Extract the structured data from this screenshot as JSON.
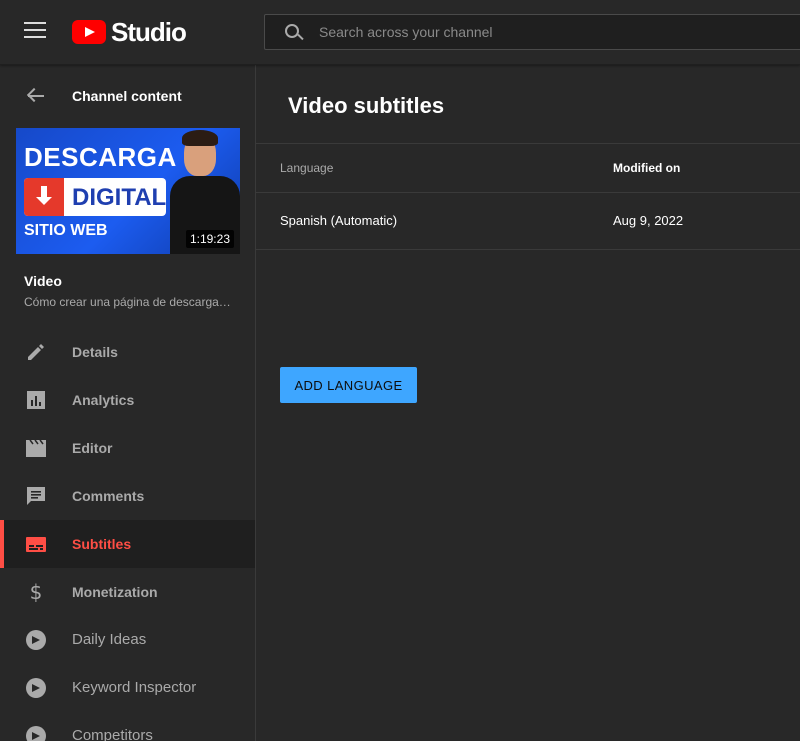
{
  "header": {
    "logo_text": "Studio",
    "search_placeholder": "Search across your channel"
  },
  "sidebar": {
    "back_label": "Channel content",
    "thumbnail": {
      "line1": "DESCARGA",
      "line2": "DIGITAL",
      "line3": "SITIO WEB",
      "duration": "1:19:23"
    },
    "video_heading": "Video",
    "video_title": "Cómo crear una página de descarga…",
    "items": [
      {
        "label": "Details",
        "icon": "pencil-icon",
        "active": false
      },
      {
        "label": "Analytics",
        "icon": "analytics-icon",
        "active": false
      },
      {
        "label": "Editor",
        "icon": "clapperboard-icon",
        "active": false
      },
      {
        "label": "Comments",
        "icon": "comment-icon",
        "active": false
      },
      {
        "label": "Subtitles",
        "icon": "subtitles-icon",
        "active": true
      },
      {
        "label": "Monetization",
        "icon": "dollar-icon",
        "active": false
      },
      {
        "label": "Daily Ideas",
        "icon": "extension-icon",
        "active": false
      },
      {
        "label": "Keyword Inspector",
        "icon": "extension-icon",
        "active": false
      },
      {
        "label": "Competitors",
        "icon": "extension-icon",
        "active": false
      }
    ]
  },
  "main": {
    "title": "Video subtitles",
    "table": {
      "headers": {
        "language": "Language",
        "modified": "Modified on"
      },
      "rows": [
        {
          "language": "Spanish (Automatic)",
          "modified": "Aug 9, 2022"
        }
      ]
    },
    "add_button": "ADD LANGUAGE"
  },
  "colors": {
    "accent_red": "#ff4e45",
    "button_blue": "#3ea6ff",
    "background": "#282828"
  }
}
